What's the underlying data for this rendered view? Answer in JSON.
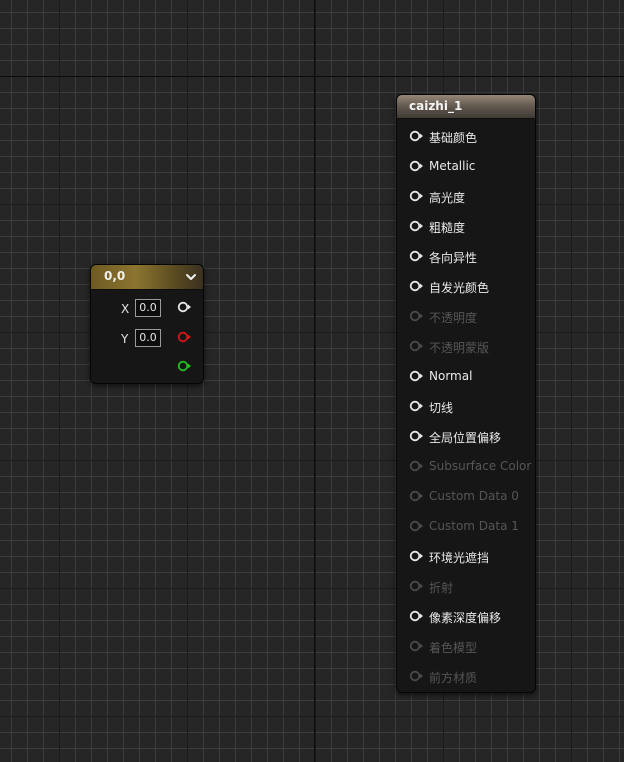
{
  "canvas": {
    "grid_minor_color": "#3e3e3e",
    "grid_major_color": "#000000",
    "background_color": "#262626"
  },
  "constant_node": {
    "title": "0,0",
    "header_color": "#8c7530",
    "rows": [
      {
        "label": "X",
        "value": "0.0",
        "pin_color": "#e6e6e6"
      },
      {
        "label": "Y",
        "value": "0.0",
        "pin_color": "#d01818"
      },
      {
        "label": "",
        "value": "",
        "pin_color": "#22c022"
      }
    ],
    "icon": "chevron-down-icon"
  },
  "material_node": {
    "title": "caizhi_1",
    "header_color": "#968676",
    "inputs": [
      {
        "label": "基础颜色",
        "enabled": true
      },
      {
        "label": "Metallic",
        "enabled": true
      },
      {
        "label": "高光度",
        "enabled": true
      },
      {
        "label": "粗糙度",
        "enabled": true
      },
      {
        "label": "各向异性",
        "enabled": true
      },
      {
        "label": "自发光颜色",
        "enabled": true
      },
      {
        "label": "不透明度",
        "enabled": false
      },
      {
        "label": "不透明蒙版",
        "enabled": false
      },
      {
        "label": "Normal",
        "enabled": true
      },
      {
        "label": "切线",
        "enabled": true
      },
      {
        "label": "全局位置偏移",
        "enabled": true
      },
      {
        "label": "Subsurface Color",
        "enabled": false
      },
      {
        "label": "Custom Data 0",
        "enabled": false
      },
      {
        "label": "Custom Data 1",
        "enabled": false
      },
      {
        "label": "环境光遮挡",
        "enabled": true
      },
      {
        "label": "折射",
        "enabled": false
      },
      {
        "label": "像素深度偏移",
        "enabled": true
      },
      {
        "label": "着色模型",
        "enabled": false
      },
      {
        "label": "前方材质",
        "enabled": false
      }
    ]
  }
}
